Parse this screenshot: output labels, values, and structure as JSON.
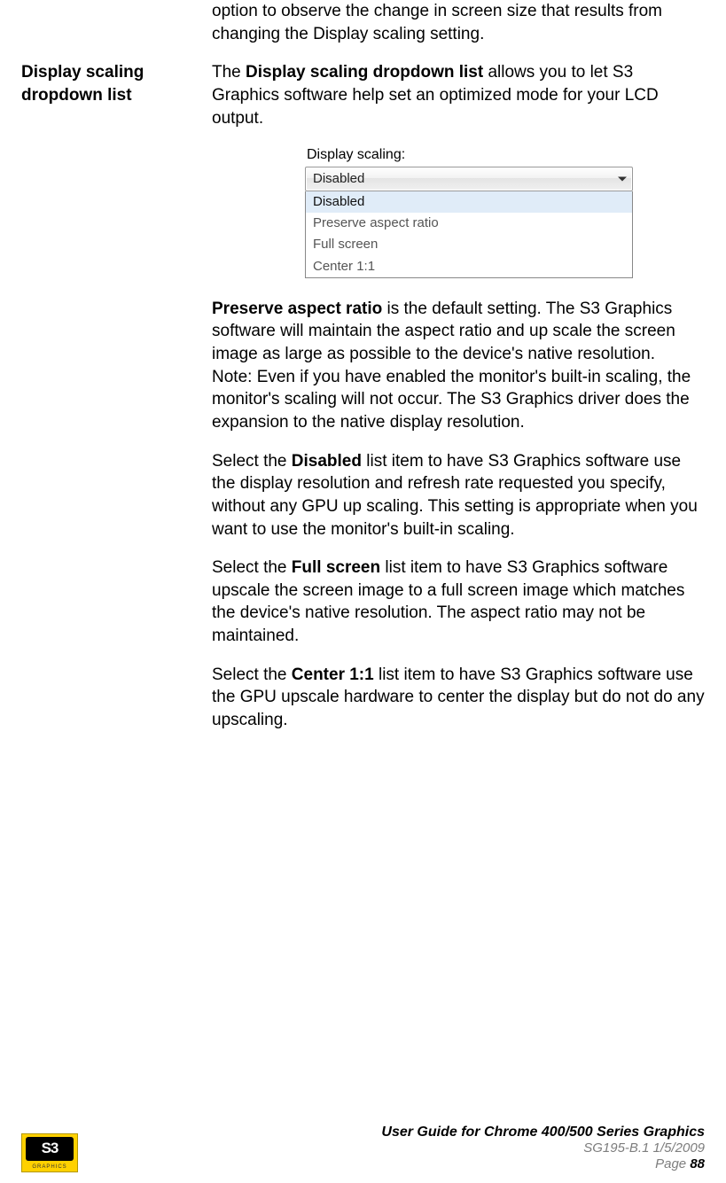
{
  "intro_trail": "option to observe the change in screen size that results from changing the Display scaling setting.",
  "section": {
    "heading": "Display scaling dropdown list",
    "p1_a": "The ",
    "p1_b": "Display scaling dropdown list",
    "p1_c": " allows you to let S3 Graphics software help set an optimized mode for your LCD output."
  },
  "dropdown": {
    "label": "Display scaling:",
    "selected": "Disabled",
    "items": [
      "Disabled",
      "Preserve aspect ratio",
      "Full screen",
      "Center 1:1"
    ]
  },
  "p2_a": "Preserve aspect ratio",
  "p2_b": " is the default setting. The S3 Graphics software will maintain the aspect ratio and up scale the screen image as large as possible to the device's native resolution.",
  "p2_note": "Note: Even if you have enabled the monitor's built-in scaling, the monitor's scaling will not occur. The S3 Graphics driver does the expansion to the native display resolution.",
  "p3_a": "Select the ",
  "p3_b": "Disabled",
  "p3_c": " list item to have S3 Graphics software use the display resolution and refresh rate requested you specify, without any GPU up scaling. This setting is appropriate when you want to use the monitor's built-in scaling.",
  "p4_a": "Select the ",
  "p4_b": "Full screen",
  "p4_c": " list item to have S3 Graphics software upscale the screen image to a full screen image which matches the device's native resolution. The aspect ratio may not be maintained.",
  "p5_a": "Select the ",
  "p5_b": "Center 1:1",
  "p5_c": " list item to have S3 Graphics software use the GPU upscale hardware to center the display but do not do any upscaling.",
  "footer": {
    "logo_text": "S3",
    "logo_sub": "GRAPHICS",
    "title": "User Guide for Chrome 400/500 Series Graphics",
    "meta": "SG195-B.1   1/5/2009",
    "page_label": "Page ",
    "page_num": "88"
  }
}
